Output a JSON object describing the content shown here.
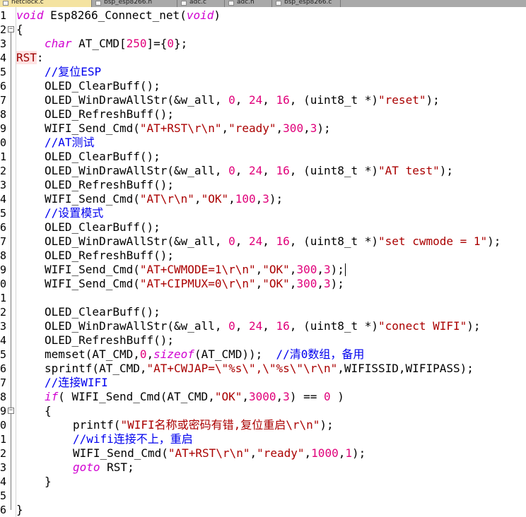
{
  "tabs": [
    {
      "label": "netclock.c",
      "active": true
    },
    {
      "label": "bsp_esp8266.h",
      "active": false
    },
    {
      "label": "adc.c",
      "active": false
    },
    {
      "label": "adc.h",
      "active": false
    },
    {
      "label": "bsp_esp8266.c",
      "active": false
    }
  ],
  "line_numbers": [
    "1",
    "2",
    "3",
    "4",
    "5",
    "6",
    "7",
    "8",
    "9",
    "0",
    "1",
    "2",
    "3",
    "4",
    "5",
    "6",
    "7",
    "8",
    "9",
    "0",
    "1",
    "2",
    "3",
    "4",
    "5",
    "6",
    "7",
    "8",
    "9",
    "0",
    "1",
    "2",
    "3",
    "4",
    "5",
    "6"
  ],
  "code": [
    {
      "ind": 0,
      "t": [
        [
          "kw",
          "void"
        ],
        [
          "p",
          " Esp8266_Connect_net("
        ],
        [
          "kw",
          "void"
        ],
        [
          "p",
          ")"
        ]
      ]
    },
    {
      "ind": 0,
      "t": [
        [
          "p",
          "{"
        ]
      ]
    },
    {
      "ind": 4,
      "t": [
        [
          "kw",
          "char"
        ],
        [
          "p",
          " AT_CMD["
        ],
        [
          "num",
          "250"
        ],
        [
          "p",
          "]={"
        ],
        [
          "num",
          "0"
        ],
        [
          "p",
          "};"
        ]
      ]
    },
    {
      "ind": 0,
      "t": [
        [
          "lbl",
          "RST"
        ],
        [
          "p",
          ":"
        ]
      ]
    },
    {
      "ind": 4,
      "t": [
        [
          "cmt",
          "//复位ESP"
        ]
      ]
    },
    {
      "ind": 4,
      "t": [
        [
          "p",
          "OLED_ClearBuff();"
        ]
      ]
    },
    {
      "ind": 4,
      "t": [
        [
          "p",
          "OLED_WinDrawAllStr(&w_all, "
        ],
        [
          "num",
          "0"
        ],
        [
          "p",
          ", "
        ],
        [
          "num",
          "24"
        ],
        [
          "p",
          ", "
        ],
        [
          "num",
          "16"
        ],
        [
          "p",
          ", (uint8_t *)"
        ],
        [
          "str",
          "\"reset\""
        ],
        [
          "p",
          ");"
        ]
      ]
    },
    {
      "ind": 4,
      "t": [
        [
          "p",
          "OLED_RefreshBuff();"
        ]
      ]
    },
    {
      "ind": 4,
      "t": [
        [
          "p",
          "WIFI_Send_Cmd("
        ],
        [
          "str",
          "\"AT+RST\\r\\n\""
        ],
        [
          "p",
          ","
        ],
        [
          "str",
          "\"ready\""
        ],
        [
          "p",
          ","
        ],
        [
          "num",
          "300"
        ],
        [
          "p",
          ","
        ],
        [
          "num",
          "3"
        ],
        [
          "p",
          ");"
        ]
      ]
    },
    {
      "ind": 4,
      "t": [
        [
          "cmt",
          "//AT测试"
        ]
      ]
    },
    {
      "ind": 4,
      "t": [
        [
          "p",
          "OLED_ClearBuff();"
        ]
      ]
    },
    {
      "ind": 4,
      "t": [
        [
          "p",
          "OLED_WinDrawAllStr(&w_all, "
        ],
        [
          "num",
          "0"
        ],
        [
          "p",
          ", "
        ],
        [
          "num",
          "24"
        ],
        [
          "p",
          ", "
        ],
        [
          "num",
          "16"
        ],
        [
          "p",
          ", (uint8_t *)"
        ],
        [
          "str",
          "\"AT test\""
        ],
        [
          "p",
          ");"
        ]
      ]
    },
    {
      "ind": 4,
      "t": [
        [
          "p",
          "OLED_RefreshBuff();"
        ]
      ]
    },
    {
      "ind": 4,
      "t": [
        [
          "p",
          "WIFI_Send_Cmd("
        ],
        [
          "str",
          "\"AT\\r\\n\""
        ],
        [
          "p",
          ","
        ],
        [
          "str",
          "\"OK\""
        ],
        [
          "p",
          ","
        ],
        [
          "num",
          "100"
        ],
        [
          "p",
          ","
        ],
        [
          "num",
          "3"
        ],
        [
          "p",
          ");"
        ]
      ]
    },
    {
      "ind": 4,
      "t": [
        [
          "cmt",
          "//设置模式"
        ]
      ]
    },
    {
      "ind": 4,
      "t": [
        [
          "p",
          "OLED_ClearBuff();"
        ]
      ]
    },
    {
      "ind": 4,
      "t": [
        [
          "p",
          "OLED_WinDrawAllStr(&w_all, "
        ],
        [
          "num",
          "0"
        ],
        [
          "p",
          ", "
        ],
        [
          "num",
          "24"
        ],
        [
          "p",
          ", "
        ],
        [
          "num",
          "16"
        ],
        [
          "p",
          ", (uint8_t *)"
        ],
        [
          "str",
          "\"set cwmode = 1\""
        ],
        [
          "p",
          ");"
        ]
      ]
    },
    {
      "ind": 4,
      "t": [
        [
          "p",
          "OLED_RefreshBuff();"
        ]
      ]
    },
    {
      "ind": 4,
      "t": [
        [
          "p",
          "WIFI_Send_Cmd("
        ],
        [
          "str",
          "\"AT+CWMODE=1\\r\\n\""
        ],
        [
          "p",
          ","
        ],
        [
          "str",
          "\"OK\""
        ],
        [
          "p",
          ","
        ],
        [
          "num",
          "300"
        ],
        [
          "p",
          ","
        ],
        [
          "num",
          "3"
        ],
        [
          "p",
          ");"
        ]
      ]
    },
    {
      "ind": 4,
      "t": [
        [
          "p",
          "WIFI_Send_Cmd("
        ],
        [
          "str",
          "\"AT+CIPMUX=0\\r\\n\""
        ],
        [
          "p",
          ","
        ],
        [
          "str",
          "\"OK\""
        ],
        [
          "p",
          ","
        ],
        [
          "num",
          "300"
        ],
        [
          "p",
          ","
        ],
        [
          "num",
          "3"
        ],
        [
          "p",
          ");"
        ]
      ]
    },
    {
      "ind": 0,
      "t": []
    },
    {
      "ind": 4,
      "t": [
        [
          "p",
          "OLED_ClearBuff();"
        ]
      ]
    },
    {
      "ind": 4,
      "t": [
        [
          "p",
          "OLED_WinDrawAllStr(&w_all, "
        ],
        [
          "num",
          "0"
        ],
        [
          "p",
          ", "
        ],
        [
          "num",
          "24"
        ],
        [
          "p",
          ", "
        ],
        [
          "num",
          "16"
        ],
        [
          "p",
          ", (uint8_t *)"
        ],
        [
          "str",
          "\"conect WIFI\""
        ],
        [
          "p",
          ");"
        ]
      ]
    },
    {
      "ind": 4,
      "t": [
        [
          "p",
          "OLED_RefreshBuff();"
        ]
      ]
    },
    {
      "ind": 4,
      "t": [
        [
          "p",
          "memset(AT_CMD,"
        ],
        [
          "num",
          "0"
        ],
        [
          "p",
          ","
        ],
        [
          "kw",
          "sizeof"
        ],
        [
          "p",
          "(AT_CMD));  "
        ],
        [
          "cmt",
          "//清0数组，备用"
        ]
      ]
    },
    {
      "ind": 4,
      "t": [
        [
          "p",
          "sprintf(AT_CMD,"
        ],
        [
          "str",
          "\"AT+CWJAP=\\\"%s\\\",\\\"%s\\\"\\r\\n\""
        ],
        [
          "p",
          ",WIFISSID,WIFIPASS);"
        ]
      ]
    },
    {
      "ind": 4,
      "t": [
        [
          "cmt",
          "//连接WIFI"
        ]
      ]
    },
    {
      "ind": 4,
      "t": [
        [
          "kw",
          "if"
        ],
        [
          "p",
          "( WIFI_Send_Cmd(AT_CMD,"
        ],
        [
          "str",
          "\"OK\""
        ],
        [
          "p",
          ","
        ],
        [
          "num",
          "3000"
        ],
        [
          "p",
          ","
        ],
        [
          "num",
          "3"
        ],
        [
          "p",
          ") == "
        ],
        [
          "num",
          "0"
        ],
        [
          "p",
          " )"
        ]
      ]
    },
    {
      "ind": 4,
      "t": [
        [
          "p",
          "{"
        ]
      ]
    },
    {
      "ind": 8,
      "t": [
        [
          "p",
          "printf("
        ],
        [
          "str",
          "\"WIFI名称或密码有错,复位重启\\r\\n\""
        ],
        [
          "p",
          ");"
        ]
      ]
    },
    {
      "ind": 8,
      "t": [
        [
          "cmt",
          "//wifi连接不上，重启"
        ]
      ]
    },
    {
      "ind": 8,
      "t": [
        [
          "p",
          "WIFI_Send_Cmd("
        ],
        [
          "str",
          "\"AT+RST\\r\\n\""
        ],
        [
          "p",
          ","
        ],
        [
          "str",
          "\"ready\""
        ],
        [
          "p",
          ","
        ],
        [
          "num",
          "1000"
        ],
        [
          "p",
          ","
        ],
        [
          "num",
          "1"
        ],
        [
          "p",
          ");"
        ]
      ]
    },
    {
      "ind": 8,
      "t": [
        [
          "kw",
          "goto"
        ],
        [
          "p",
          " RST;"
        ]
      ]
    },
    {
      "ind": 4,
      "t": [
        [
          "p",
          "}"
        ]
      ]
    },
    {
      "ind": 0,
      "t": []
    },
    {
      "ind": 0,
      "t": [
        [
          "p",
          "}"
        ]
      ]
    }
  ]
}
